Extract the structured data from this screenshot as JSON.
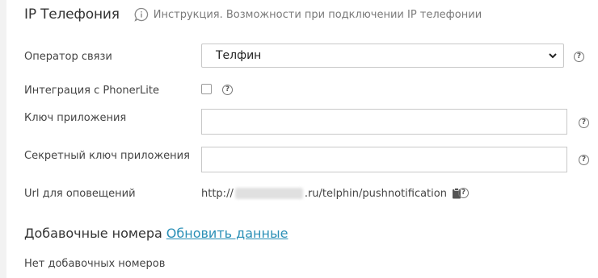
{
  "header": {
    "title": "IP Телефония",
    "instruction_text": "Инструкция. Возможности при подключении IP телефонии",
    "instruction_icon": "speech-bubble-info-icon"
  },
  "form": {
    "operator": {
      "label": "Оператор связи",
      "selected": "Телфин"
    },
    "phonerlite": {
      "label": "Интеграция с PhonerLite",
      "checked": false
    },
    "app_key": {
      "label": "Ключ приложения",
      "value": ""
    },
    "secret_key": {
      "label": "Секретный ключ приложения",
      "value": ""
    },
    "notify_url": {
      "label": "Url для оповещений",
      "prefix": "http://",
      "suffix": ".ru/telphin/pushnotification",
      "copy_icon": "clipboard-icon"
    },
    "help_glyph": "?"
  },
  "extensions": {
    "title": "Добавочные номера",
    "refresh_link": "Обновить данные",
    "empty_text": "Нет добавочных номеров"
  },
  "colors": {
    "link": "#2a8fb6",
    "muted": "#7a7a7a",
    "border": "#c8c8c8"
  }
}
